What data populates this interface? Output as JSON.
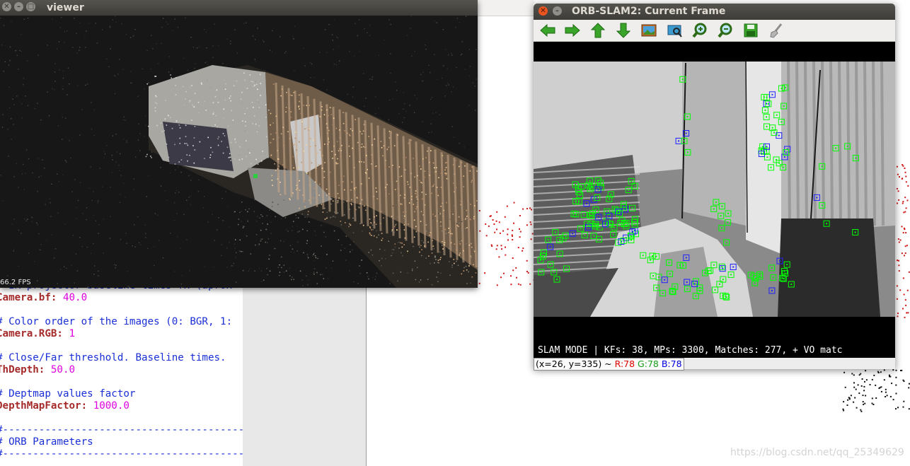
{
  "editor": {
    "lines": [
      {
        "type": "comment",
        "text": "# IR projector baseline times fx (aprox"
      },
      {
        "type": "kv",
        "key": "Camera.bf",
        "value": "40.0"
      },
      {
        "type": "blank"
      },
      {
        "type": "comment",
        "text": "# Color order of the images (0: BGR, 1:"
      },
      {
        "type": "kv",
        "key": "Camera.RGB",
        "value": "1"
      },
      {
        "type": "blank"
      },
      {
        "type": "comment",
        "text": "# Close/Far threshold. Baseline times."
      },
      {
        "type": "kv",
        "key": "ThDepth",
        "value": "50.0"
      },
      {
        "type": "blank"
      },
      {
        "type": "comment",
        "text": "# Deptmap values factor"
      },
      {
        "type": "kv",
        "key": "DepthMapFactor",
        "value": "1000.0"
      },
      {
        "type": "blank"
      },
      {
        "type": "comment",
        "text": "#---------------------------------------------"
      },
      {
        "type": "comment",
        "text": "# ORB Parameters"
      },
      {
        "type": "comment",
        "text": "#---------------------------------------------"
      }
    ]
  },
  "viewer": {
    "title": "viewer",
    "fps": "66.2 FPS"
  },
  "orb_window": {
    "title": "ORB-SLAM2: Current Frame",
    "toolbar": [
      {
        "name": "back-arrow-icon"
      },
      {
        "name": "forward-arrow-icon"
      },
      {
        "name": "up-arrow-icon"
      },
      {
        "name": "down-arrow-icon"
      },
      {
        "name": "image-icon"
      },
      {
        "name": "fit-window-icon"
      },
      {
        "name": "zoom-in-icon"
      },
      {
        "name": "zoom-out-icon"
      },
      {
        "name": "save-icon"
      },
      {
        "name": "brush-icon"
      }
    ],
    "status_text": "SLAM MODE |  KFs: 38, MPs: 3300, Matches: 277, + VO matc",
    "pixel_info": {
      "coords": "(x=26, y=335) ~",
      "r": "R:78",
      "g": "G:78",
      "b": "B:78"
    }
  },
  "watermark": "https://blog.csdn.net/qq_25349629",
  "colors": {
    "titlebar": "#3c3b37",
    "close_button": "#e95420",
    "keypoint_green": "#00ff00",
    "keypoint_blue": "#1a1aff",
    "comment_blue": "#1a2fd6",
    "key_brown": "#a52a2a",
    "value_magenta": "#e000e0"
  }
}
